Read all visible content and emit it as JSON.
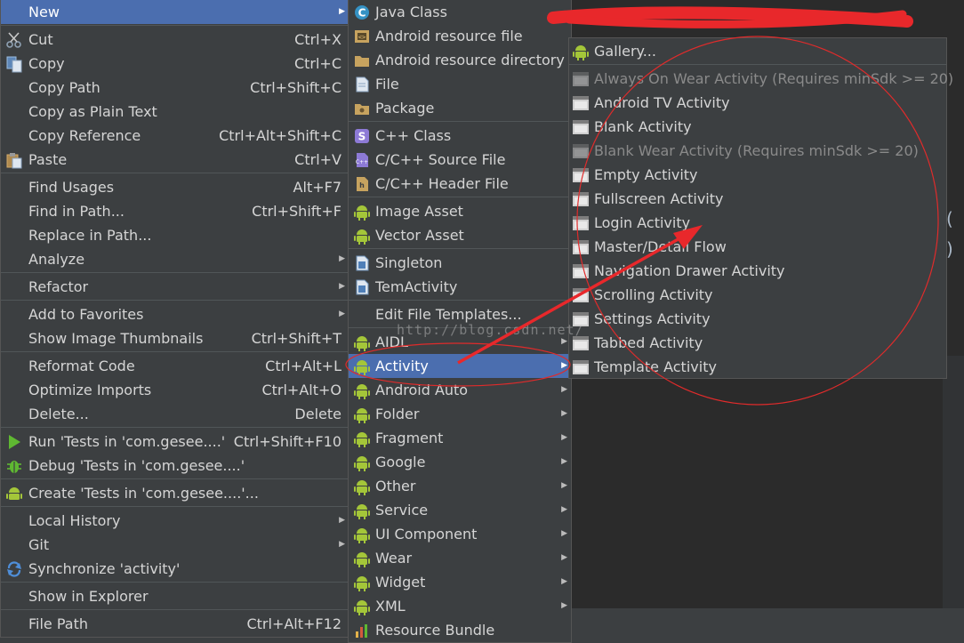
{
  "editor": {
    "paren_1": "(",
    "paren_2": ")"
  },
  "menu1": {
    "items": [
      {
        "label": "New",
        "shortcut": "",
        "submenu": true,
        "icon": "none"
      },
      {
        "label": "Cut",
        "shortcut": "Ctrl+X",
        "icon": "scissors-icon"
      },
      {
        "label": "Copy",
        "shortcut": "Ctrl+C",
        "icon": "copy-icon"
      },
      {
        "label": "Copy Path",
        "shortcut": "Ctrl+Shift+C",
        "icon": "none"
      },
      {
        "label": "Copy as Plain Text",
        "shortcut": "",
        "icon": "none"
      },
      {
        "label": "Copy Reference",
        "shortcut": "Ctrl+Alt+Shift+C",
        "icon": "none"
      },
      {
        "label": "Paste",
        "shortcut": "Ctrl+V",
        "icon": "paste-icon"
      },
      {
        "label": "Find Usages",
        "shortcut": "Alt+F7",
        "icon": "none"
      },
      {
        "label": "Find in Path...",
        "shortcut": "Ctrl+Shift+F",
        "icon": "none"
      },
      {
        "label": "Replace in Path...",
        "shortcut": "",
        "icon": "none"
      },
      {
        "label": "Analyze",
        "shortcut": "",
        "submenu": true,
        "icon": "none"
      },
      {
        "label": "Refactor",
        "shortcut": "",
        "submenu": true,
        "icon": "none"
      },
      {
        "label": "Add to Favorites",
        "shortcut": "",
        "submenu": true,
        "icon": "none"
      },
      {
        "label": "Show Image Thumbnails",
        "shortcut": "Ctrl+Shift+T",
        "icon": "none"
      },
      {
        "label": "Reformat Code",
        "shortcut": "Ctrl+Alt+L",
        "icon": "none"
      },
      {
        "label": "Optimize Imports",
        "shortcut": "Ctrl+Alt+O",
        "icon": "none"
      },
      {
        "label": "Delete...",
        "shortcut": "Delete",
        "icon": "none"
      },
      {
        "label": "Run 'Tests in 'com.gesee....'",
        "shortcut": "Ctrl+Shift+F10",
        "icon": "run-icon"
      },
      {
        "label": "Debug 'Tests in 'com.gesee....'",
        "shortcut": "",
        "icon": "debug-icon"
      },
      {
        "label": "Create 'Tests in 'com.gesee....'...",
        "shortcut": "",
        "icon": "android-icon"
      },
      {
        "label": "Local History",
        "shortcut": "",
        "submenu": true,
        "icon": "none"
      },
      {
        "label": "Git",
        "shortcut": "",
        "submenu": true,
        "icon": "none"
      },
      {
        "label": "Synchronize 'activity'",
        "shortcut": "",
        "icon": "sync-icon"
      },
      {
        "label": "Show in Explorer",
        "shortcut": "",
        "icon": "none"
      },
      {
        "label": "File Path",
        "shortcut": "Ctrl+Alt+F12",
        "icon": "none"
      }
    ]
  },
  "menu2": {
    "items": [
      {
        "label": "Java Class",
        "icon": "java-class-icon"
      },
      {
        "label": "Android resource file",
        "icon": "android-resource-file-icon"
      },
      {
        "label": "Android resource directory",
        "icon": "folder-icon"
      },
      {
        "label": "File",
        "icon": "file-icon"
      },
      {
        "label": "Package",
        "icon": "package-icon"
      },
      {
        "label": "C++ Class",
        "icon": "cpp-class-icon"
      },
      {
        "label": "C/C++ Source File",
        "icon": "cpp-source-icon"
      },
      {
        "label": "C/C++ Header File",
        "icon": "cpp-header-icon"
      },
      {
        "label": "Image Asset",
        "icon": "android-icon"
      },
      {
        "label": "Vector Asset",
        "icon": "android-icon"
      },
      {
        "label": "Singleton",
        "icon": "template-file-icon"
      },
      {
        "label": "TemActivity",
        "icon": "template-file-icon"
      },
      {
        "label": "Edit File Templates...",
        "icon": "none"
      },
      {
        "label": "AIDL",
        "icon": "android-icon",
        "submenu": true
      },
      {
        "label": "Activity",
        "icon": "android-icon",
        "submenu": true
      },
      {
        "label": "Android Auto",
        "icon": "android-icon",
        "submenu": true
      },
      {
        "label": "Folder",
        "icon": "android-icon",
        "submenu": true
      },
      {
        "label": "Fragment",
        "icon": "android-icon",
        "submenu": true
      },
      {
        "label": "Google",
        "icon": "android-icon",
        "submenu": true
      },
      {
        "label": "Other",
        "icon": "android-icon",
        "submenu": true
      },
      {
        "label": "Service",
        "icon": "android-icon",
        "submenu": true
      },
      {
        "label": "UI Component",
        "icon": "android-icon",
        "submenu": true
      },
      {
        "label": "Wear",
        "icon": "android-icon",
        "submenu": true
      },
      {
        "label": "Widget",
        "icon": "android-icon",
        "submenu": true
      },
      {
        "label": "XML",
        "icon": "android-icon",
        "submenu": true
      },
      {
        "label": "Resource Bundle",
        "icon": "resource-bundle-icon"
      }
    ]
  },
  "menu3": {
    "items": [
      {
        "label": "Gallery...",
        "icon": "android-icon",
        "disabled": false
      },
      {
        "label": "Always On Wear Activity (Requires minSdk >= 20)",
        "icon": "activity-template-icon",
        "disabled": true
      },
      {
        "label": "Android TV Activity",
        "icon": "activity-template-icon",
        "disabled": false
      },
      {
        "label": "Blank Activity",
        "icon": "activity-template-icon",
        "disabled": false
      },
      {
        "label": "Blank Wear Activity (Requires minSdk >= 20)",
        "icon": "activity-template-icon",
        "disabled": true
      },
      {
        "label": "Empty Activity",
        "icon": "activity-template-icon",
        "disabled": false
      },
      {
        "label": "Fullscreen Activity",
        "icon": "activity-template-icon",
        "disabled": false
      },
      {
        "label": "Login Activity",
        "icon": "activity-template-icon",
        "disabled": false
      },
      {
        "label": "Master/Detail Flow",
        "icon": "activity-template-icon",
        "disabled": false
      },
      {
        "label": "Navigation Drawer Activity",
        "icon": "activity-template-icon",
        "disabled": false
      },
      {
        "label": "Scrolling Activity",
        "icon": "activity-template-icon",
        "disabled": false
      },
      {
        "label": "Settings Activity",
        "icon": "activity-template-icon",
        "disabled": false
      },
      {
        "label": "Tabbed Activity",
        "icon": "activity-template-icon",
        "disabled": false
      },
      {
        "label": "Template Activity",
        "icon": "activity-template-icon",
        "disabled": false
      }
    ]
  },
  "watermark": "http://blog.csdn.net/",
  "colors": {
    "menu_bg": "#3c3f41",
    "selection": "#4b6eaf",
    "android_green": "#a4c639",
    "annotation_red": "#e8282b"
  }
}
